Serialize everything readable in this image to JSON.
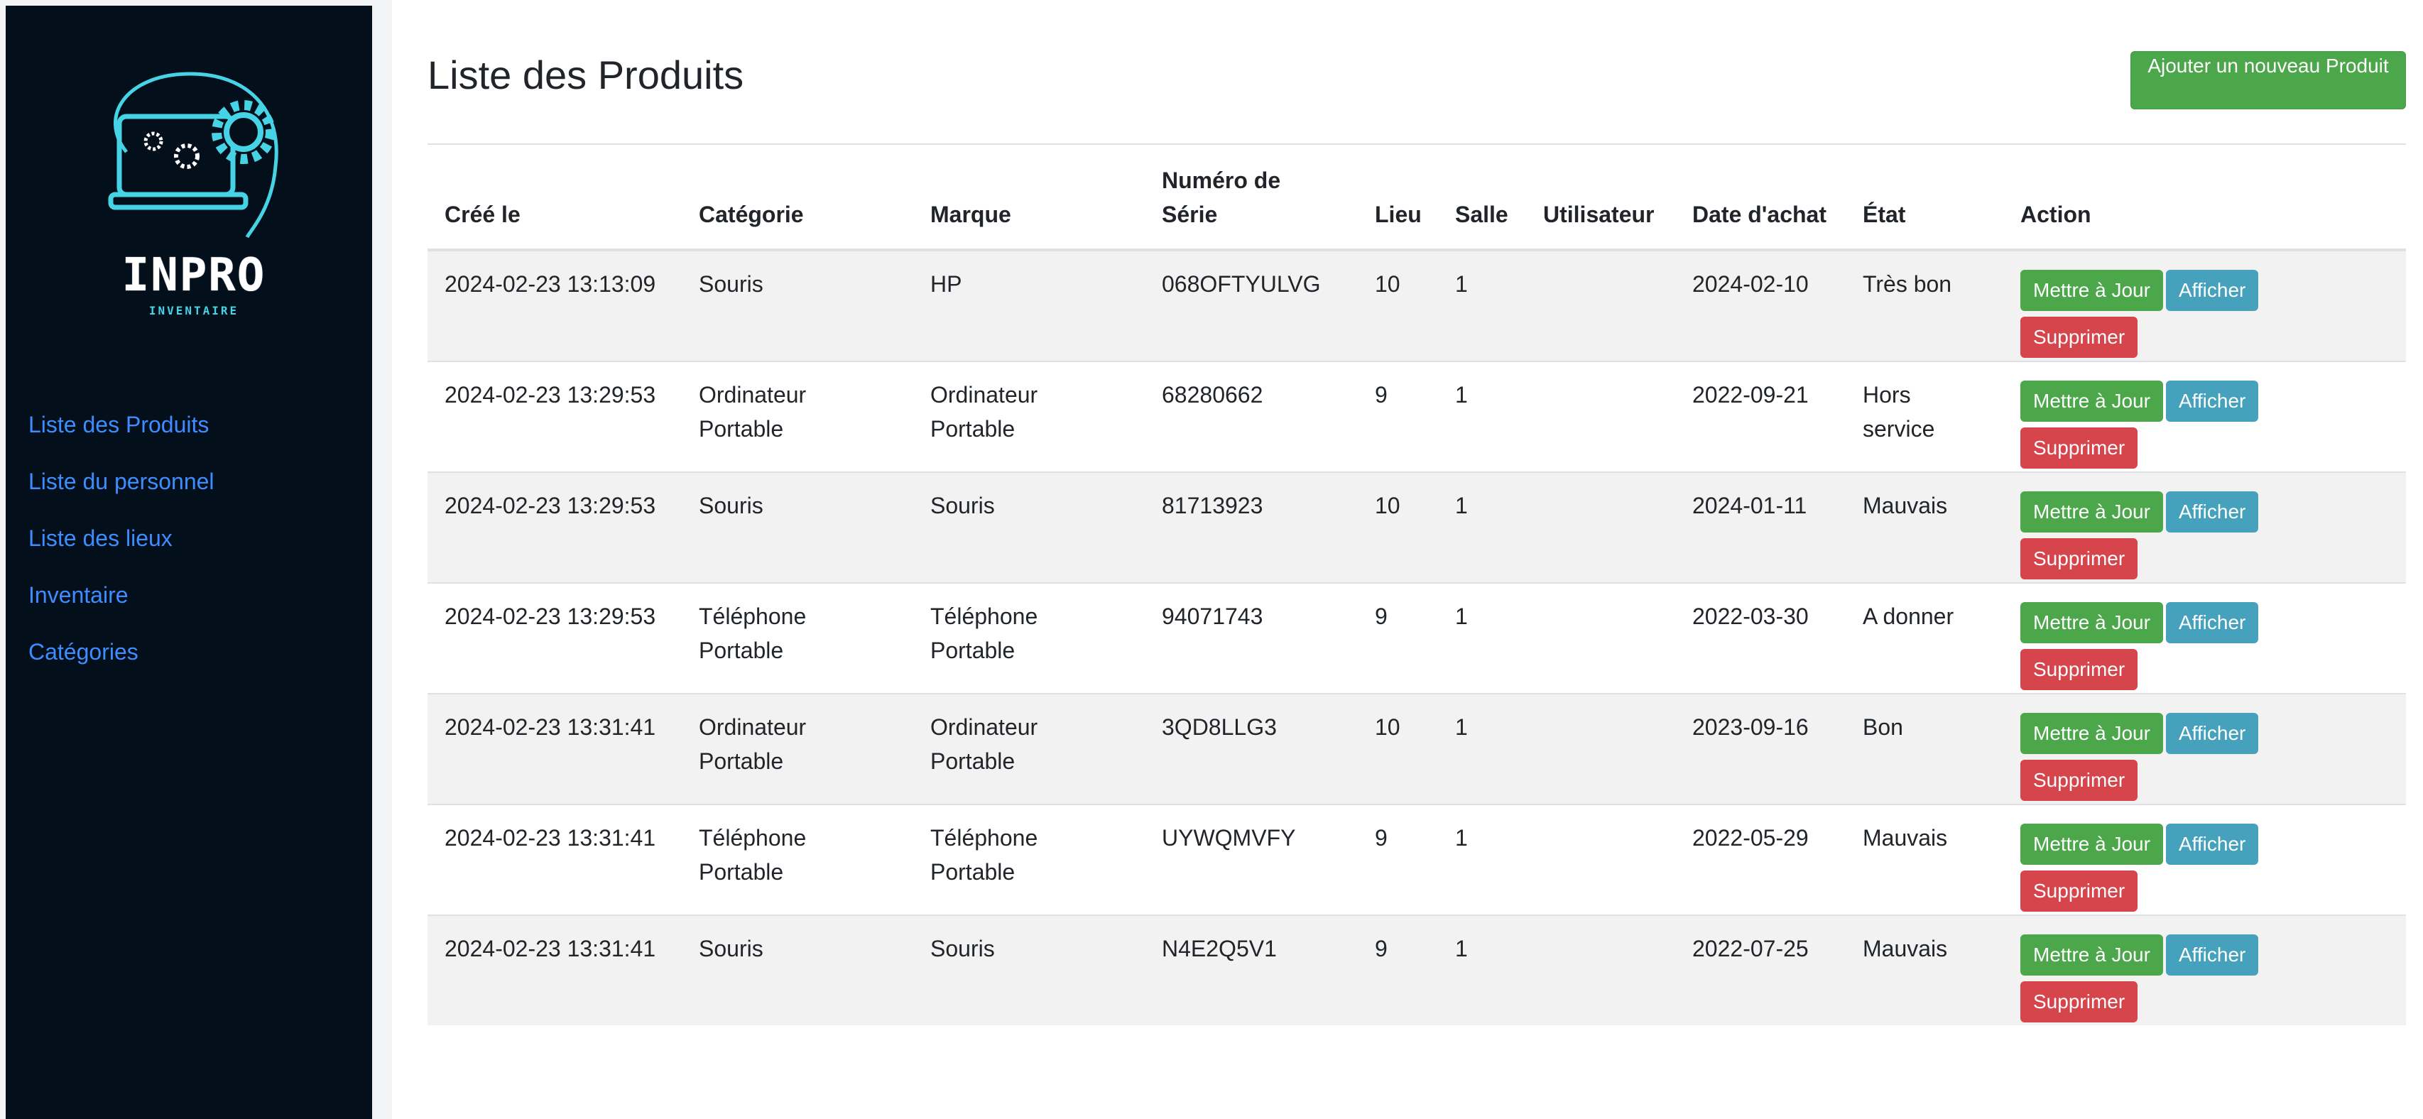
{
  "sidebar": {
    "logo": {
      "word": "INPRO",
      "sub": "INVENTAIRE"
    },
    "items": [
      {
        "label": "Liste des Produits"
      },
      {
        "label": "Liste du personnel"
      },
      {
        "label": "Liste des lieux"
      },
      {
        "label": "Inventaire"
      },
      {
        "label": "Catégories"
      }
    ]
  },
  "main": {
    "title": "Liste des Produits",
    "add_button": "Ajouter un nouveau Produit",
    "table": {
      "headers": {
        "created": "Créé le",
        "category": "Catégorie",
        "brand": "Marque",
        "serial": "Numéro de Série",
        "location": "Lieu",
        "room": "Salle",
        "user": "Utilisateur",
        "purchase_date": "Date d'achat",
        "state": "État",
        "action": "Action"
      },
      "actions": {
        "update": "Mettre à Jour",
        "show": "Afficher",
        "delete": "Supprimer"
      },
      "rows": [
        {
          "created": "2024-02-23 13:13:09",
          "category": "Souris",
          "brand": "HP",
          "serial": "068OFTYULVG",
          "location": "10",
          "room": "1",
          "user": "",
          "purchase_date": "2024-02-10",
          "state": "Très bon"
        },
        {
          "created": "2024-02-23 13:29:53",
          "category": "Ordinateur Portable",
          "brand": "Ordinateur Portable",
          "serial": "68280662",
          "location": "9",
          "room": "1",
          "user": "",
          "purchase_date": "2022-09-21",
          "state": "Hors service"
        },
        {
          "created": "2024-02-23 13:29:53",
          "category": "Souris",
          "brand": "Souris",
          "serial": "81713923",
          "location": "10",
          "room": "1",
          "user": "",
          "purchase_date": "2024-01-11",
          "state": "Mauvais"
        },
        {
          "created": "2024-02-23 13:29:53",
          "category": "Téléphone Portable",
          "brand": "Téléphone Portable",
          "serial": "94071743",
          "location": "9",
          "room": "1",
          "user": "",
          "purchase_date": "2022-03-30",
          "state": "A donner"
        },
        {
          "created": "2024-02-23 13:31:41",
          "category": "Ordinateur Portable",
          "brand": "Ordinateur Portable",
          "serial": "3QD8LLG3",
          "location": "10",
          "room": "1",
          "user": "",
          "purchase_date": "2023-09-16",
          "state": "Bon"
        },
        {
          "created": "2024-02-23 13:31:41",
          "category": "Téléphone Portable",
          "brand": "Téléphone Portable",
          "serial": "UYWQMVFY",
          "location": "9",
          "room": "1",
          "user": "",
          "purchase_date": "2022-05-29",
          "state": "Mauvais"
        },
        {
          "created": "2024-02-23 13:31:41",
          "category": "Souris",
          "brand": "Souris",
          "serial": "N4E2Q5V1",
          "location": "9",
          "room": "1",
          "user": "",
          "purchase_date": "2022-07-25",
          "state": "Mauvais"
        }
      ]
    }
  },
  "colors": {
    "sidebar_bg": "#040f1c",
    "nav_link": "#3f8cff",
    "logo_accent": "#47d3e6",
    "btn_update": "#4ca64a",
    "btn_show": "#46a2bc",
    "btn_delete": "#d6444c",
    "stripe": "#f2f2f2"
  }
}
